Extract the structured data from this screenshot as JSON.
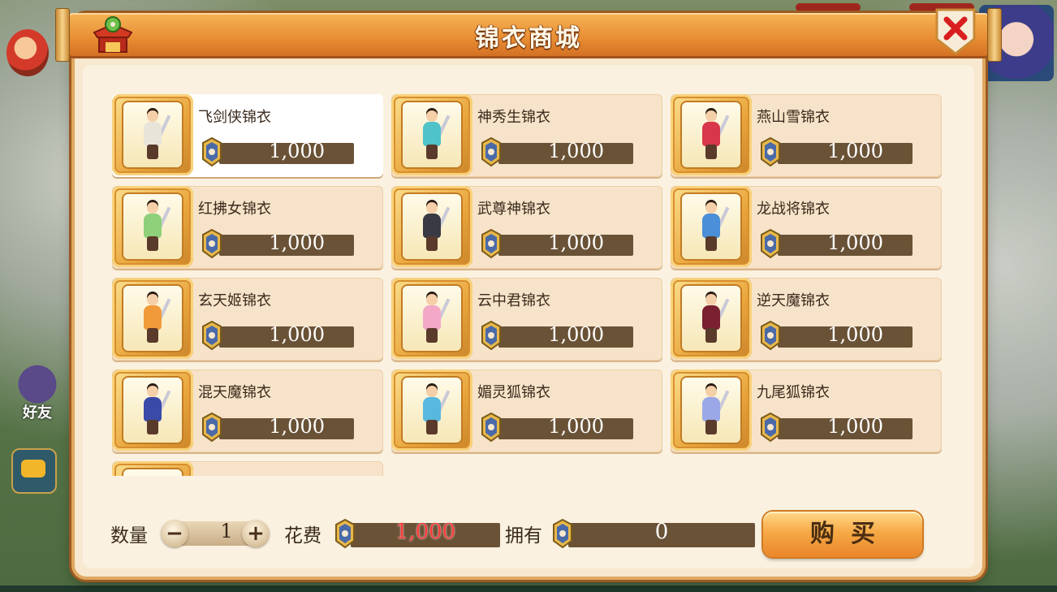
{
  "dialog": {
    "title": "锦衣商城"
  },
  "items": [
    {
      "name": "飞剑侠锦衣",
      "price": "1,000",
      "selected": true,
      "color": "#e9e4da"
    },
    {
      "name": "神秀生锦衣",
      "price": "1,000",
      "selected": false,
      "color": "#4fc3c8"
    },
    {
      "name": "燕山雪锦衣",
      "price": "1,000",
      "selected": false,
      "color": "#d8364a"
    },
    {
      "name": "红拂女锦衣",
      "price": "1,000",
      "selected": false,
      "color": "#8fd07a"
    },
    {
      "name": "武尊神锦衣",
      "price": "1,000",
      "selected": false,
      "color": "#3a3a44"
    },
    {
      "name": "龙战将锦衣",
      "price": "1,000",
      "selected": false,
      "color": "#4a8fd8"
    },
    {
      "name": "玄天姬锦衣",
      "price": "1,000",
      "selected": false,
      "color": "#f09a3a"
    },
    {
      "name": "云中君锦衣",
      "price": "1,000",
      "selected": false,
      "color": "#f3a8c8"
    },
    {
      "name": "逆天魔锦衣",
      "price": "1,000",
      "selected": false,
      "color": "#7a2030"
    },
    {
      "name": "混天魔锦衣",
      "price": "1,000",
      "selected": false,
      "color": "#3a4aa8"
    },
    {
      "name": "媚灵狐锦衣",
      "price": "1,000",
      "selected": false,
      "color": "#58b8e0"
    },
    {
      "name": "九尾狐锦衣",
      "price": "1,000",
      "selected": false,
      "color": "#9aa8e8"
    },
    {
      "name": "",
      "price": "",
      "selected": false,
      "color": "#e9a53c"
    }
  ],
  "purchase": {
    "qty_label": "数量",
    "qty_value": "1",
    "minus_label": "−",
    "plus_label": "+",
    "cost_label": "花费",
    "cost_value": "1,000",
    "own_label": "拥有",
    "own_value": "0",
    "buy_label": "购买"
  },
  "background": {
    "friend_label": "好友"
  },
  "colors": {
    "accent": "#e98e34",
    "panel": "#f7e8cf",
    "price_bar": "#6a5236",
    "cost_red": "#ff3b3b"
  }
}
